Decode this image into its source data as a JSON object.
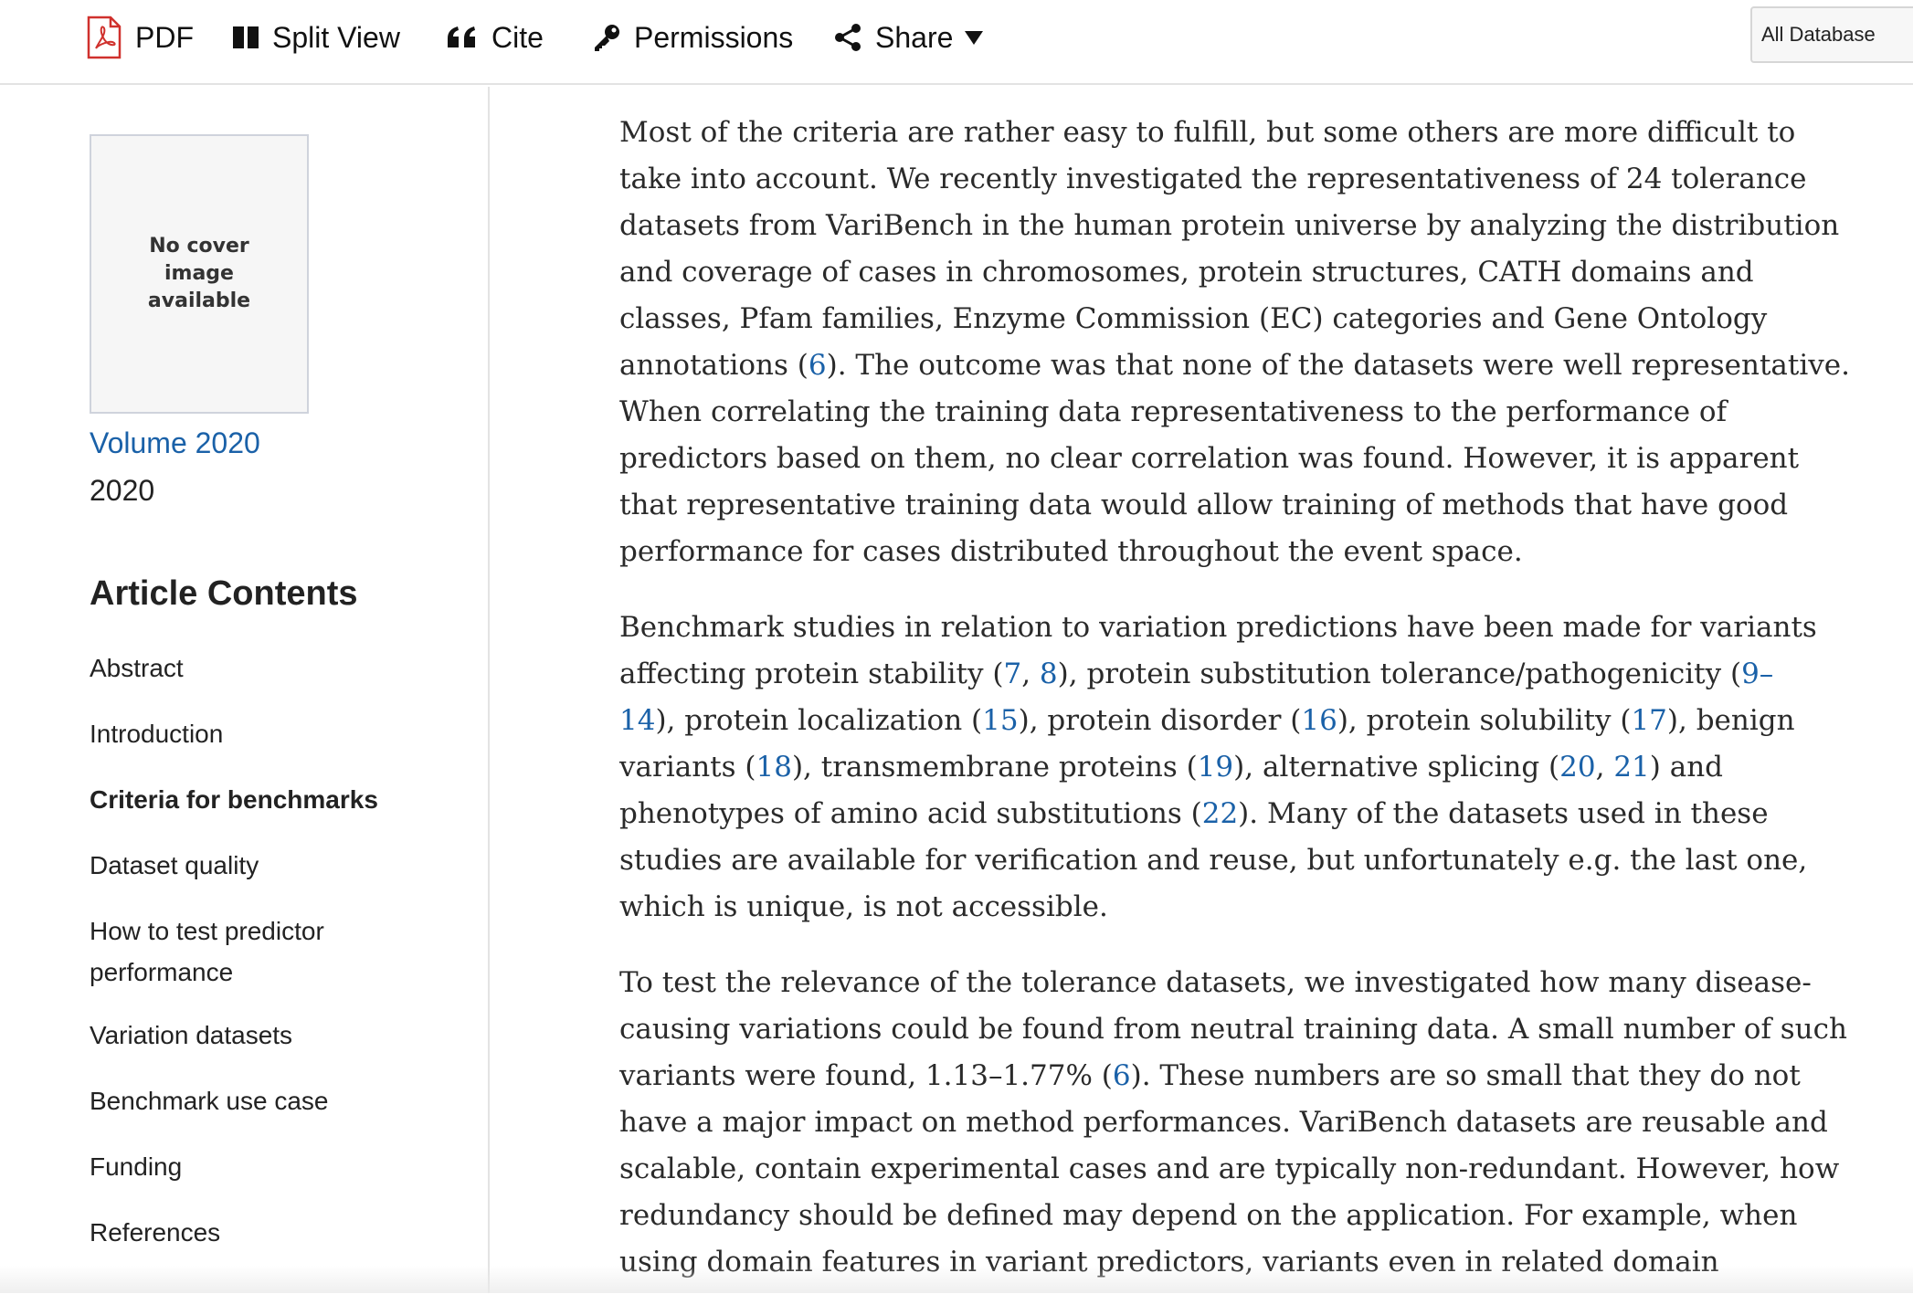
{
  "toolbar": {
    "pdf_label": "PDF",
    "split_view_label": "Split View",
    "cite_label": "Cite",
    "permissions_label": "Permissions",
    "share_label": "Share",
    "database_select_value": "All Database",
    "icons": {
      "pdf": "pdf-icon",
      "split": "split-view-icon",
      "cite": "quote-icon",
      "permissions": "key-icon",
      "share": "share-icon",
      "caret": "caret-down-icon"
    },
    "accent_pdf": "#d0312d"
  },
  "sidebar": {
    "cover_text": "No cover image available",
    "volume_link": "Volume 2020",
    "year": "2020",
    "contents_heading": "Article Contents",
    "toc": [
      {
        "label": "Abstract",
        "active": false
      },
      {
        "label": "Introduction",
        "active": false
      },
      {
        "label": "Criteria for benchmarks",
        "active": true
      },
      {
        "label": "Dataset quality",
        "active": false
      },
      {
        "label": "How to test predictor performance",
        "active": false
      },
      {
        "label": "Variation datasets",
        "active": false
      },
      {
        "label": "Benchmark use case",
        "active": false
      },
      {
        "label": "Funding",
        "active": false
      },
      {
        "label": "References",
        "active": false
      }
    ]
  },
  "article": {
    "link_color": "#1a61a8",
    "paragraphs": [
      [
        [
          {
            "t": "Most of the criteria are rather easy to fulfill, but some others are more difficult to"
          }
        ],
        [
          {
            "t": "take into account. We recently investigated the representativeness of 24 tolerance"
          }
        ],
        [
          {
            "t": "datasets from VariBench in the human protein universe by analyzing the distribution"
          }
        ],
        [
          {
            "t": "and coverage of cases in chromosomes, protein structures, CATH domains and"
          }
        ],
        [
          {
            "t": "classes, Pfam families, Enzyme Commission (EC) categories and Gene Ontology"
          }
        ],
        [
          {
            "t": "annotations ("
          },
          {
            "t": "6",
            "ref": true
          },
          {
            "t": "). The outcome was that none of the datasets were well representative."
          }
        ],
        [
          {
            "t": "When correlating the training data representativeness to the performance of"
          }
        ],
        [
          {
            "t": "predictors based on them, no clear correlation was found. However, it is apparent"
          }
        ],
        [
          {
            "t": "that representative training data would allow training of methods that have good"
          }
        ],
        [
          {
            "t": "performance for cases distributed throughout the event space."
          }
        ]
      ],
      [
        [
          {
            "t": "Benchmark studies in relation to variation predictions have been made for variants"
          }
        ],
        [
          {
            "t": "affecting protein stability ("
          },
          {
            "t": "7",
            "ref": true
          },
          {
            "t": ", "
          },
          {
            "t": "8",
            "ref": true
          },
          {
            "t": "), protein substitution tolerance/pathogenicity ("
          },
          {
            "t": "9–",
            "ref": true
          }
        ],
        [
          {
            "t": "14",
            "ref": true
          },
          {
            "t": "), protein localization ("
          },
          {
            "t": "15",
            "ref": true
          },
          {
            "t": "), protein disorder ("
          },
          {
            "t": "16",
            "ref": true
          },
          {
            "t": "), protein solubility ("
          },
          {
            "t": "17",
            "ref": true
          },
          {
            "t": "), benign"
          }
        ],
        [
          {
            "t": "variants ("
          },
          {
            "t": "18",
            "ref": true
          },
          {
            "t": "), transmembrane proteins ("
          },
          {
            "t": "19",
            "ref": true
          },
          {
            "t": "), alternative splicing ("
          },
          {
            "t": "20",
            "ref": true
          },
          {
            "t": ", "
          },
          {
            "t": "21",
            "ref": true
          },
          {
            "t": ") and"
          }
        ],
        [
          {
            "t": "phenotypes of amino acid substitutions ("
          },
          {
            "t": "22",
            "ref": true
          },
          {
            "t": "). Many of the datasets used in these"
          }
        ],
        [
          {
            "t": "studies are available for verification and reuse, but unfortunately e.g. the last one,"
          }
        ],
        [
          {
            "t": "which is unique, is not accessible."
          }
        ]
      ],
      [
        [
          {
            "t": "To test the relevance of the tolerance datasets, we investigated how many disease-"
          }
        ],
        [
          {
            "t": "causing variations could be found from neutral training data. A small number of such"
          }
        ],
        [
          {
            "t": "variants were found, 1.13–1.77% ("
          },
          {
            "t": "6",
            "ref": true
          },
          {
            "t": "). These numbers are so small that they do not"
          }
        ],
        [
          {
            "t": "have a major impact on method performances. VariBench datasets are reusable and"
          }
        ],
        [
          {
            "t": "scalable, contain experimental cases and are typically non-redundant. However, how"
          }
        ],
        [
          {
            "t": "redundancy should be defined may depend on the application. For example, when"
          }
        ],
        [
          {
            "t": "using domain features in variant predictors, variants even in related domain"
          }
        ]
      ]
    ]
  }
}
